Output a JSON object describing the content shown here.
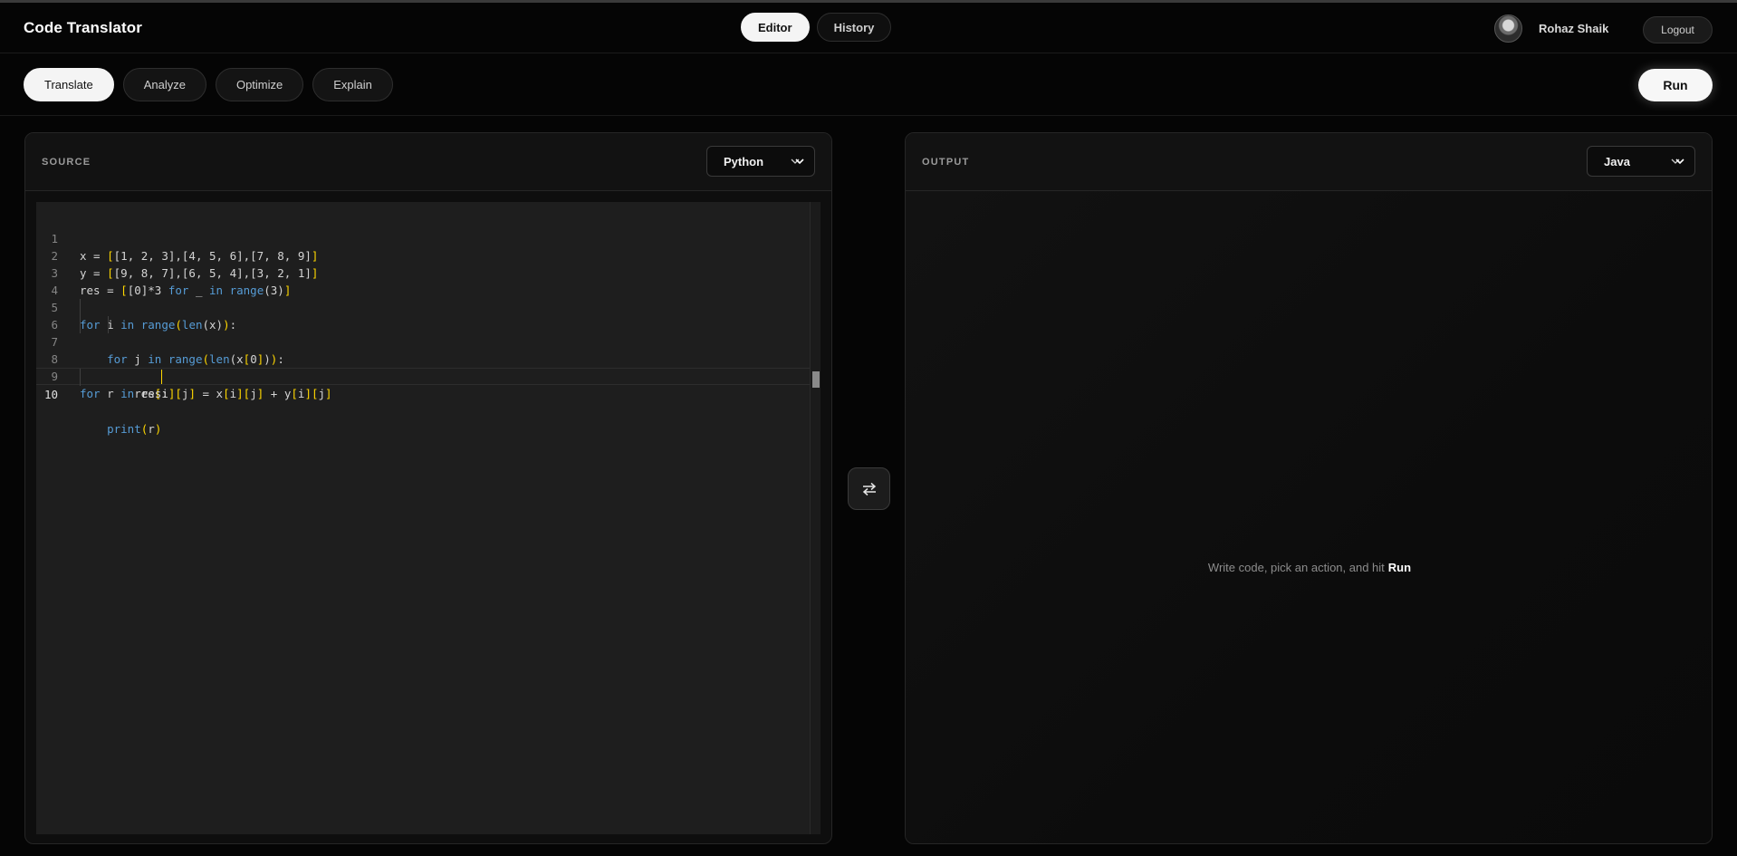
{
  "app": {
    "title": "Code Translator"
  },
  "nav": {
    "tabs": [
      {
        "label": "Editor",
        "active": true
      },
      {
        "label": "History",
        "active": false
      }
    ]
  },
  "user": {
    "name": "Rohaz Shaik",
    "logout_label": "Logout"
  },
  "actions": {
    "items": [
      {
        "label": "Translate",
        "active": true
      },
      {
        "label": "Analyze",
        "active": false
      },
      {
        "label": "Optimize",
        "active": false
      },
      {
        "label": "Explain",
        "active": false
      }
    ],
    "run_label": "Run"
  },
  "source": {
    "title": "SOURCE",
    "language": "Python",
    "code_lines": [
      "x = [[1, 2, 3],[4, 5, 6],[7, 8, 9]]",
      "y = [[9, 8, 7],[6, 5, 4],[3, 2, 1]]",
      "res = [[0]*3 for _ in range(3)]",
      "",
      "for i in range(len(x)):",
      "    for j in range(len(x[0])):",
      "        res[i][j] = x[i][j] + y[i][j]",
      "",
      "for r in res:",
      "    print(r)"
    ],
    "current_line": 10
  },
  "swap": {
    "icon": "swap-arrows-icon"
  },
  "output": {
    "title": "OUTPUT",
    "language": "Java",
    "placeholder_text": "Write code, pick an action, and hit",
    "placeholder_action": "Run"
  },
  "colors": {
    "background": "#050505",
    "panel": "#0e0e0e",
    "editor": "#1e1e1e",
    "keyword": "#569cd6",
    "bracket": "#ffd700",
    "active_pill": "#f4f4f4"
  }
}
